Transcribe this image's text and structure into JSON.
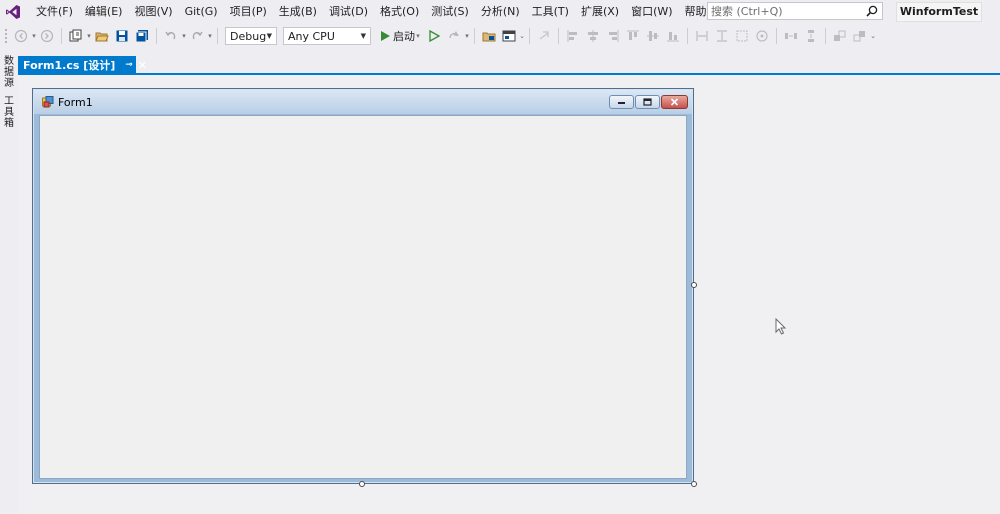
{
  "menu": [
    "文件(F)",
    "编辑(E)",
    "视图(V)",
    "Git(G)",
    "项目(P)",
    "生成(B)",
    "调试(D)",
    "格式(O)",
    "测试(S)",
    "分析(N)",
    "工具(T)",
    "扩展(X)",
    "窗口(W)",
    "帮助(H)"
  ],
  "search": {
    "placeholder": "搜索 (Ctrl+Q)",
    "icon": "search-icon"
  },
  "solution_name": "WinformTest",
  "toolbar": {
    "configuration": "Debug",
    "platform": "Any CPU",
    "start_label": "启动"
  },
  "tab": {
    "label": "Form1.cs [设计]",
    "pin_glyph": "⊸",
    "close_glyph": "✕"
  },
  "side_panels": [
    "数据源",
    "工具箱"
  ],
  "form": {
    "title": "Form1"
  },
  "colors": {
    "accent": "#007acc",
    "start_green": "#388a34",
    "close_red": "#c75050"
  }
}
